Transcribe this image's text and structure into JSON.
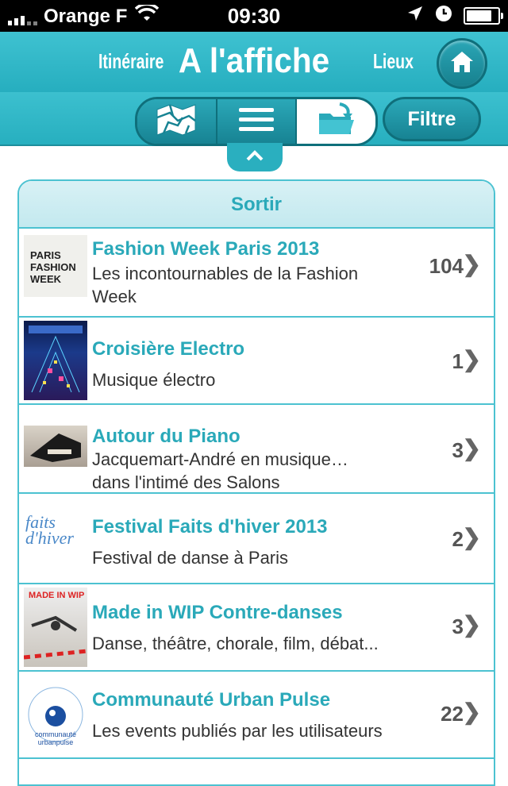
{
  "status": {
    "carrier": "Orange F",
    "time": "09:30",
    "battery_level": 0.9
  },
  "header": {
    "left_label": "Itinéraire",
    "title": "A l'affiche",
    "right_label": "Lieux"
  },
  "toolbar": {
    "filter_label": "Filtre"
  },
  "section": {
    "title": "Sortir"
  },
  "items": [
    {
      "title": "Fashion Week Paris 2013",
      "subtitle": "Les incontournables de la Fashion Week",
      "count": "104",
      "thumb_text": "PARIS FASHION WEEK"
    },
    {
      "title": "Croisière Electro",
      "subtitle": "Musique électro",
      "count": "1"
    },
    {
      "title": "Autour du Piano",
      "subtitle": "Jacquemart-André en musique… dans l'intimé des Salons",
      "count": "3"
    },
    {
      "title": "Festival Faits d'hiver 2013",
      "subtitle": "Festival de danse à Paris",
      "count": "2",
      "thumb_text": "faits d'hiver"
    },
    {
      "title": "Made in WIP Contre-danses",
      "subtitle": "Danse, théâtre, chorale, film, débat...",
      "count": "3",
      "thumb_text": "MADE IN WIP"
    },
    {
      "title": "Communauté Urban Pulse",
      "subtitle": "Les events publiés par les utilisateurs",
      "count": "22",
      "thumb_text": "communauté urbanpulse"
    }
  ],
  "icons": {
    "signal": "signal-bars-icon",
    "wifi": "wifi-icon",
    "location": "location-arrow-icon",
    "clock": "clock-icon",
    "battery": "battery-icon",
    "home": "home-icon",
    "map": "map-icon",
    "list": "list-icon",
    "folder": "folder-download-icon",
    "collapse": "chevron-up-icon",
    "chevron": "chevron-right-icon"
  }
}
